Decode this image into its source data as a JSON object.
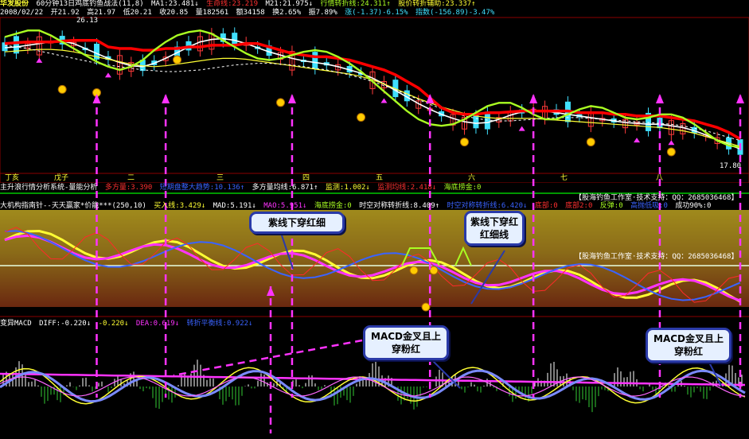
{
  "header": {
    "stock_name": "华发股份",
    "indicator_title": "60分钟13日鸡底钓鱼战法(11,8)",
    "ma1": "MA1:23.481↓",
    "life_line": "生命线:23.219",
    "ma21": "M21:21.975↓",
    "turn_line": "行情转折线:24.311↑",
    "assist_line": "股价转折辅助:23.337↑"
  },
  "quote_bar": {
    "date": "2008/02/22",
    "open": "开21.92",
    "high": "高21.97",
    "low": "低20.21",
    "close": "收20.85",
    "volume": "量182561",
    "amount": "额34158",
    "turnover": "换2.65%",
    "amplitude": "振7.89%",
    "change": "涨(-1.37)-6.15%",
    "index": "指数(-156.89)-3.47%"
  },
  "price_chart": {
    "max_label": "26.13",
    "min_label": "17.80",
    "day_labels": [
      "丁亥",
      "戊子",
      "二",
      "三",
      "四",
      "五",
      "六",
      "七",
      "八"
    ]
  },
  "volume_panel": {
    "title": "主升浪行情分析系统-量能分析",
    "items": [
      "多方量:3.390",
      "短期盘整大趋势:10.136↑",
      "多方量均线:6.871↑",
      "监测:1.002↓",
      "监测均线:2.418↓",
      "海底捞金:0"
    ],
    "watermark": "【股海钓鱼工作室·技术支持：QQ：2685036468】"
  },
  "osc_panel": {
    "title": "大机构指南针--天天赢家*价能***(250,10)",
    "items": [
      "买入线:3.429↓",
      "MAD:5.191↓",
      "MAO:5.951↓",
      "海底捞金:0",
      "时空对称转折线:8.409↑",
      "时空对称转折线:6.420↓",
      "底部:0",
      "底部2:0",
      "反弹:0",
      "高抛低吸:0",
      "成功90%:0"
    ],
    "watermark": "【股海钓鱼工作室·技术支持：QQ：2685036468】"
  },
  "macd_panel": {
    "title": "变异MACD",
    "items": [
      "DIFF:-0.220↓",
      "-0.220↓",
      "DEA:0.619↓",
      "转折平衡线:0.922↓"
    ]
  },
  "callouts": {
    "c1": "紫线下穿红细",
    "c2": "紫线下穿红红细线",
    "c3": "MACD金叉且上穿粉红",
    "c4": "MACD金叉且上穿粉红"
  },
  "colors": {
    "up": "#ff3b3b",
    "down": "#40e0ff",
    "white_line": "#ffffff",
    "yellow_line": "#ffff33",
    "green_line": "#aaff22",
    "red_line": "#ff0000",
    "blue_line": "#3a63ff",
    "magenta": "#ff33ff",
    "callout_border": "#2a3aa8",
    "band_top": "#a08a1c",
    "band_bottom": "#6a2810"
  },
  "chart_data": {
    "type": "line",
    "x": [
      0,
      1,
      2,
      3,
      4,
      5,
      6,
      7,
      8,
      9,
      10,
      11,
      12,
      13,
      14,
      15,
      16,
      17,
      18,
      19,
      20,
      21,
      22,
      23,
      24,
      25,
      26,
      27,
      28,
      29,
      30,
      31,
      32,
      33,
      34,
      35,
      36,
      37,
      38,
      39,
      40,
      41,
      42,
      43,
      44,
      45,
      46,
      47,
      48,
      49,
      50,
      51,
      52,
      53,
      54,
      55,
      56,
      57,
      58,
      59,
      60,
      61,
      62,
      63,
      64
    ],
    "series": [
      {
        "name": "MA1",
        "values": [
          24.95,
          25.0,
          25.1,
          25.2,
          25.3,
          25.35,
          25.2,
          24.9,
          24.6,
          24.3,
          24.05,
          23.85,
          23.8,
          24.0,
          24.3,
          24.65,
          25.0,
          25.3,
          25.45,
          25.5,
          25.4,
          25.2,
          24.95,
          24.7,
          24.5,
          24.3,
          24.15,
          24.05,
          23.95,
          23.8,
          23.6,
          23.4,
          23.1,
          22.75,
          22.35,
          21.95,
          21.55,
          21.2,
          20.9,
          20.65,
          20.45,
          20.35,
          20.4,
          20.6,
          20.85,
          21.05,
          21.15,
          21.1,
          21.0,
          20.9,
          20.8,
          20.7,
          20.6,
          20.5,
          20.4,
          20.35,
          20.3,
          20.3,
          20.2,
          20.1,
          19.9,
          19.65,
          19.35,
          19.05,
          18.8
        ]
      },
      {
        "name": "生命线",
        "values": [
          24.7,
          24.75,
          24.8,
          24.85,
          24.85,
          24.8,
          24.7,
          24.55,
          24.4,
          24.25,
          24.1,
          23.95,
          23.85,
          23.8,
          23.85,
          23.95,
          24.05,
          24.15,
          24.25,
          24.3,
          24.3,
          24.25,
          24.15,
          24.05,
          23.95,
          23.85,
          23.75,
          23.65,
          23.55,
          23.45,
          23.35,
          23.2,
          23.0,
          22.75,
          22.45,
          22.15,
          21.85,
          21.6,
          21.35,
          21.15,
          20.95,
          20.8,
          20.7,
          20.65,
          20.65,
          20.65,
          20.65,
          20.6,
          20.55,
          20.5,
          20.45,
          20.4,
          20.35,
          20.3,
          20.25,
          20.2,
          20.15,
          20.1,
          20.0,
          19.9,
          19.75,
          19.55,
          19.35,
          19.15,
          18.95
        ]
      },
      {
        "name": "M21",
        "values": [
          25.1,
          25.0,
          24.9,
          24.75,
          24.6,
          24.45,
          24.3,
          24.15,
          24.0,
          23.9,
          23.8,
          23.7,
          23.6,
          23.55,
          23.5,
          23.5,
          23.55,
          23.6,
          23.7,
          23.8,
          23.9,
          23.95,
          24.0,
          24.0,
          23.95,
          23.9,
          23.8,
          23.7,
          23.6,
          23.45,
          23.3,
          23.1,
          22.9,
          22.65,
          22.4,
          22.1,
          21.8,
          21.5,
          21.25,
          21.0,
          20.8,
          20.65,
          20.55,
          20.5,
          20.5,
          20.55,
          20.6,
          20.65,
          20.7,
          20.7,
          20.7,
          20.65,
          20.6,
          20.55,
          20.5,
          20.45,
          20.4,
          20.35,
          20.3,
          20.2,
          20.05,
          19.9,
          19.7,
          19.5,
          19.3
        ]
      },
      {
        "name": "行情转折线",
        "values": [
          25.2,
          25.25,
          25.3,
          25.3,
          25.3,
          25.35,
          25.4,
          25.4,
          25.4,
          25.0,
          24.9,
          24.9,
          24.8,
          24.8,
          24.9,
          24.9,
          25.0,
          25.0,
          25.1,
          25.1,
          25.1,
          25.2,
          25.2,
          25.0,
          24.8,
          24.6,
          24.5,
          24.4,
          24.4,
          24.3,
          24.2,
          24.0,
          23.8,
          23.6,
          23.3,
          22.9,
          22.5,
          21.9,
          21.3,
          21.0,
          20.9,
          20.9,
          21.0,
          21.0,
          21.05,
          21.1,
          21.1,
          21.1,
          21.1,
          21.1,
          21.0,
          21.0,
          21.0,
          20.9,
          20.9,
          20.8,
          20.8,
          20.8,
          20.7,
          20.6,
          20.5,
          20.3,
          20.1,
          19.8,
          19.4
        ]
      },
      {
        "name": "股价转折辅助",
        "values": [
          25.6,
          25.8,
          26.0,
          26.0,
          25.7,
          25.3,
          24.9,
          24.5,
          24.1,
          23.8,
          23.6,
          23.8,
          24.2,
          24.8,
          25.3,
          25.7,
          25.9,
          26.0,
          25.8,
          25.4,
          25.0,
          24.6,
          24.3,
          24.2,
          24.3,
          24.5,
          24.7,
          24.8,
          24.7,
          24.4,
          24.0,
          23.5,
          22.9,
          22.3,
          21.7,
          21.1,
          20.6,
          20.3,
          20.2,
          20.3,
          20.6,
          21.0,
          21.4,
          21.6,
          21.6,
          21.3,
          20.9,
          20.6,
          20.6,
          20.9,
          21.2,
          21.4,
          21.3,
          21.0,
          20.7,
          20.6,
          20.7,
          20.9,
          20.9,
          20.7,
          20.3,
          19.8,
          19.3,
          19.0,
          18.9
        ]
      }
    ],
    "ylim": [
      17.6,
      26.4
    ],
    "annotations": [
      "26.13",
      "17.80"
    ],
    "vertical_markers_x": [
      8,
      14,
      25,
      37,
      46,
      57,
      64
    ]
  }
}
